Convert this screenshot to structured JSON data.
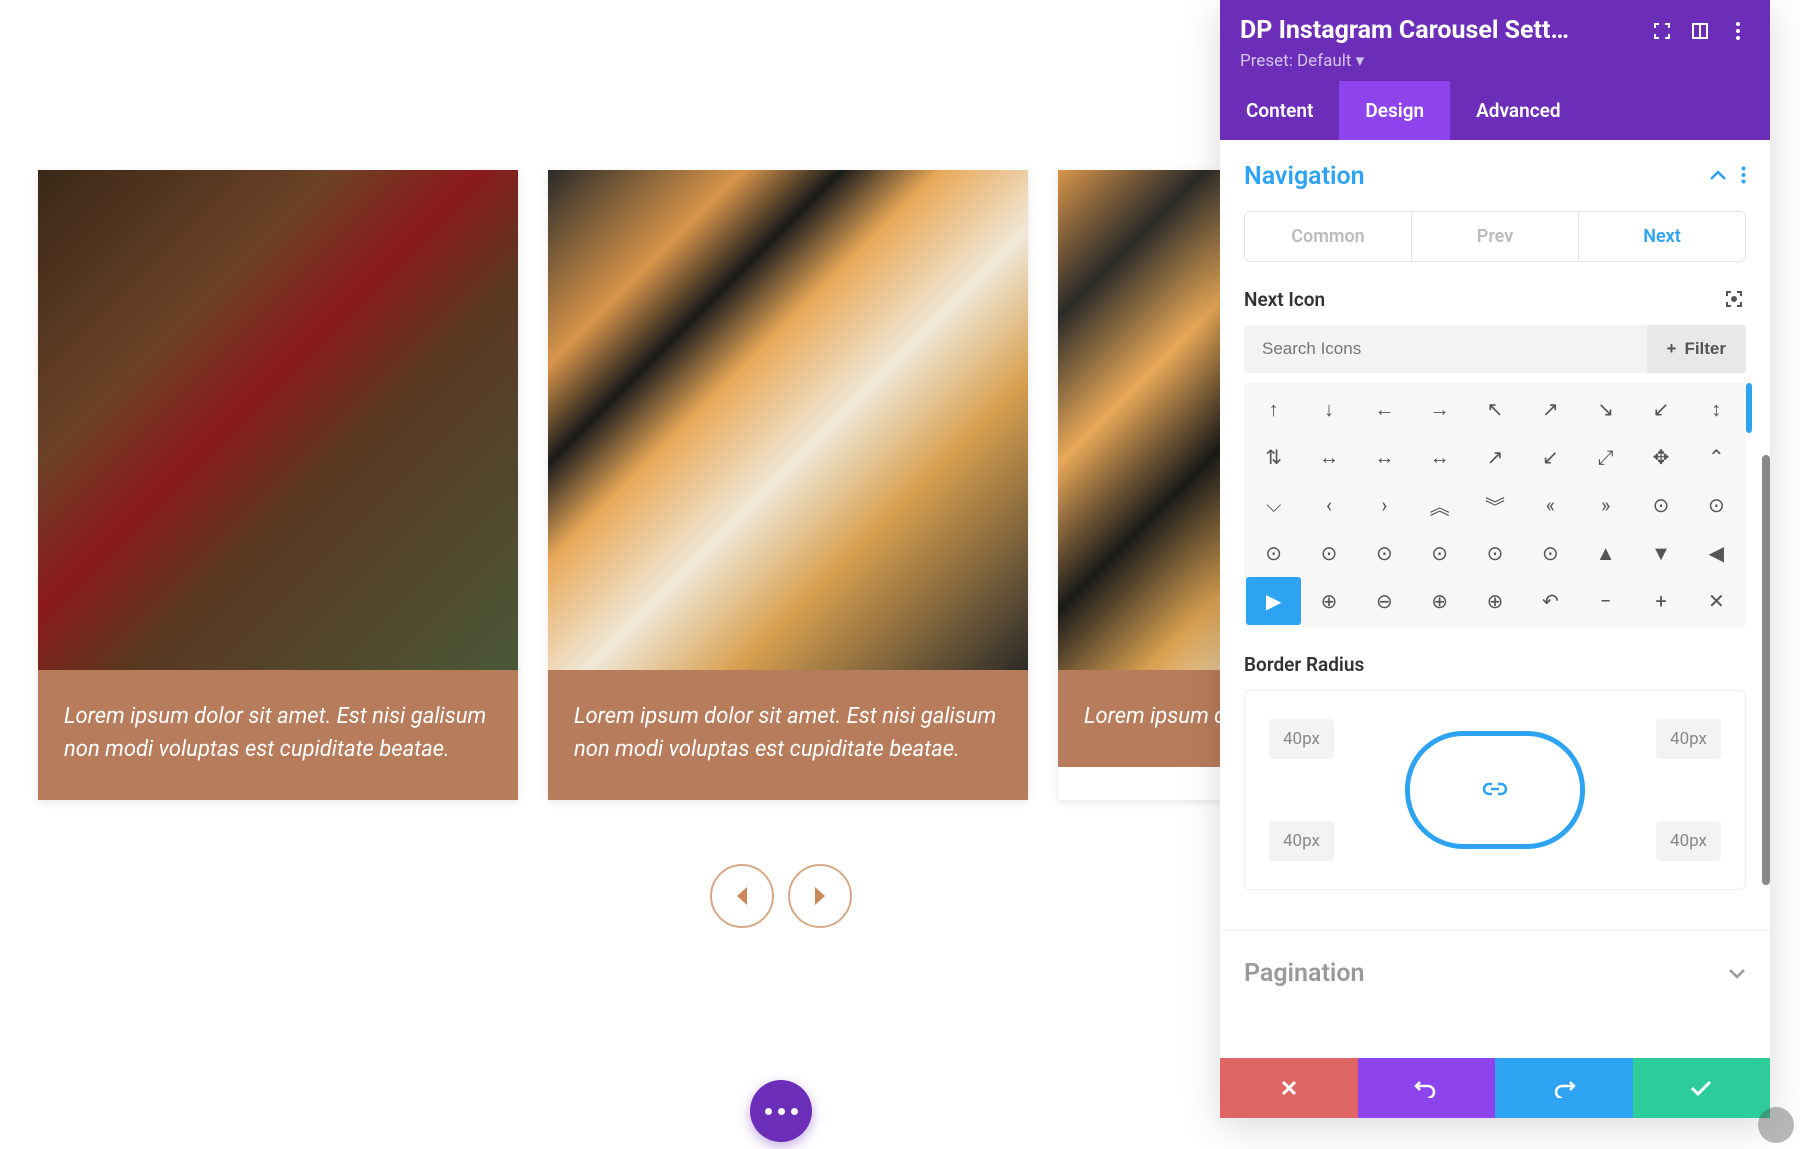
{
  "carousel": {
    "cards": [
      {
        "caption": "Lorem ipsum dolor sit amet. Est nisi galisum non modi voluptas est cupiditate beatae."
      },
      {
        "caption": "Lorem ipsum dolor sit amet. Est nisi galisum non modi voluptas est cupiditate beatae."
      },
      {
        "caption": "Lorem ipsum do"
      }
    ]
  },
  "panel": {
    "title": "DP Instagram Carousel Sett…",
    "preset": "Preset: Default ▾",
    "tabs": {
      "content": "Content",
      "design": "Design",
      "advanced": "Advanced"
    },
    "navigation": {
      "title": "Navigation",
      "subtabs": {
        "common": "Common",
        "prev": "Prev",
        "next": "Next"
      },
      "next_icon_label": "Next Icon",
      "search_placeholder": "Search Icons",
      "filter_label": "Filter",
      "icons": [
        "↑",
        "↓",
        "←",
        "→",
        "↖",
        "↗",
        "↘",
        "↙",
        "↕",
        "⇅",
        "↔",
        "↔",
        "↔",
        "↗",
        "↙",
        "⤢",
        "✥",
        "⌃",
        "⌵",
        "‹",
        "›",
        "︽",
        "︾",
        "«",
        "»",
        "⊙",
        "⊙",
        "⊙",
        "⊙",
        "⊙",
        "⊙",
        "⊙",
        "⊙",
        "▲",
        "▼",
        "◀",
        "▶",
        "⊕",
        "⊖",
        "⊕",
        "⊕",
        "↶",
        "−",
        "+",
        "✕"
      ],
      "selected_icon_index": 36,
      "border_radius_label": "Border Radius",
      "border_radius": {
        "tl": "40px",
        "tr": "40px",
        "bl": "40px",
        "br": "40px"
      }
    },
    "pagination_title": "Pagination"
  }
}
